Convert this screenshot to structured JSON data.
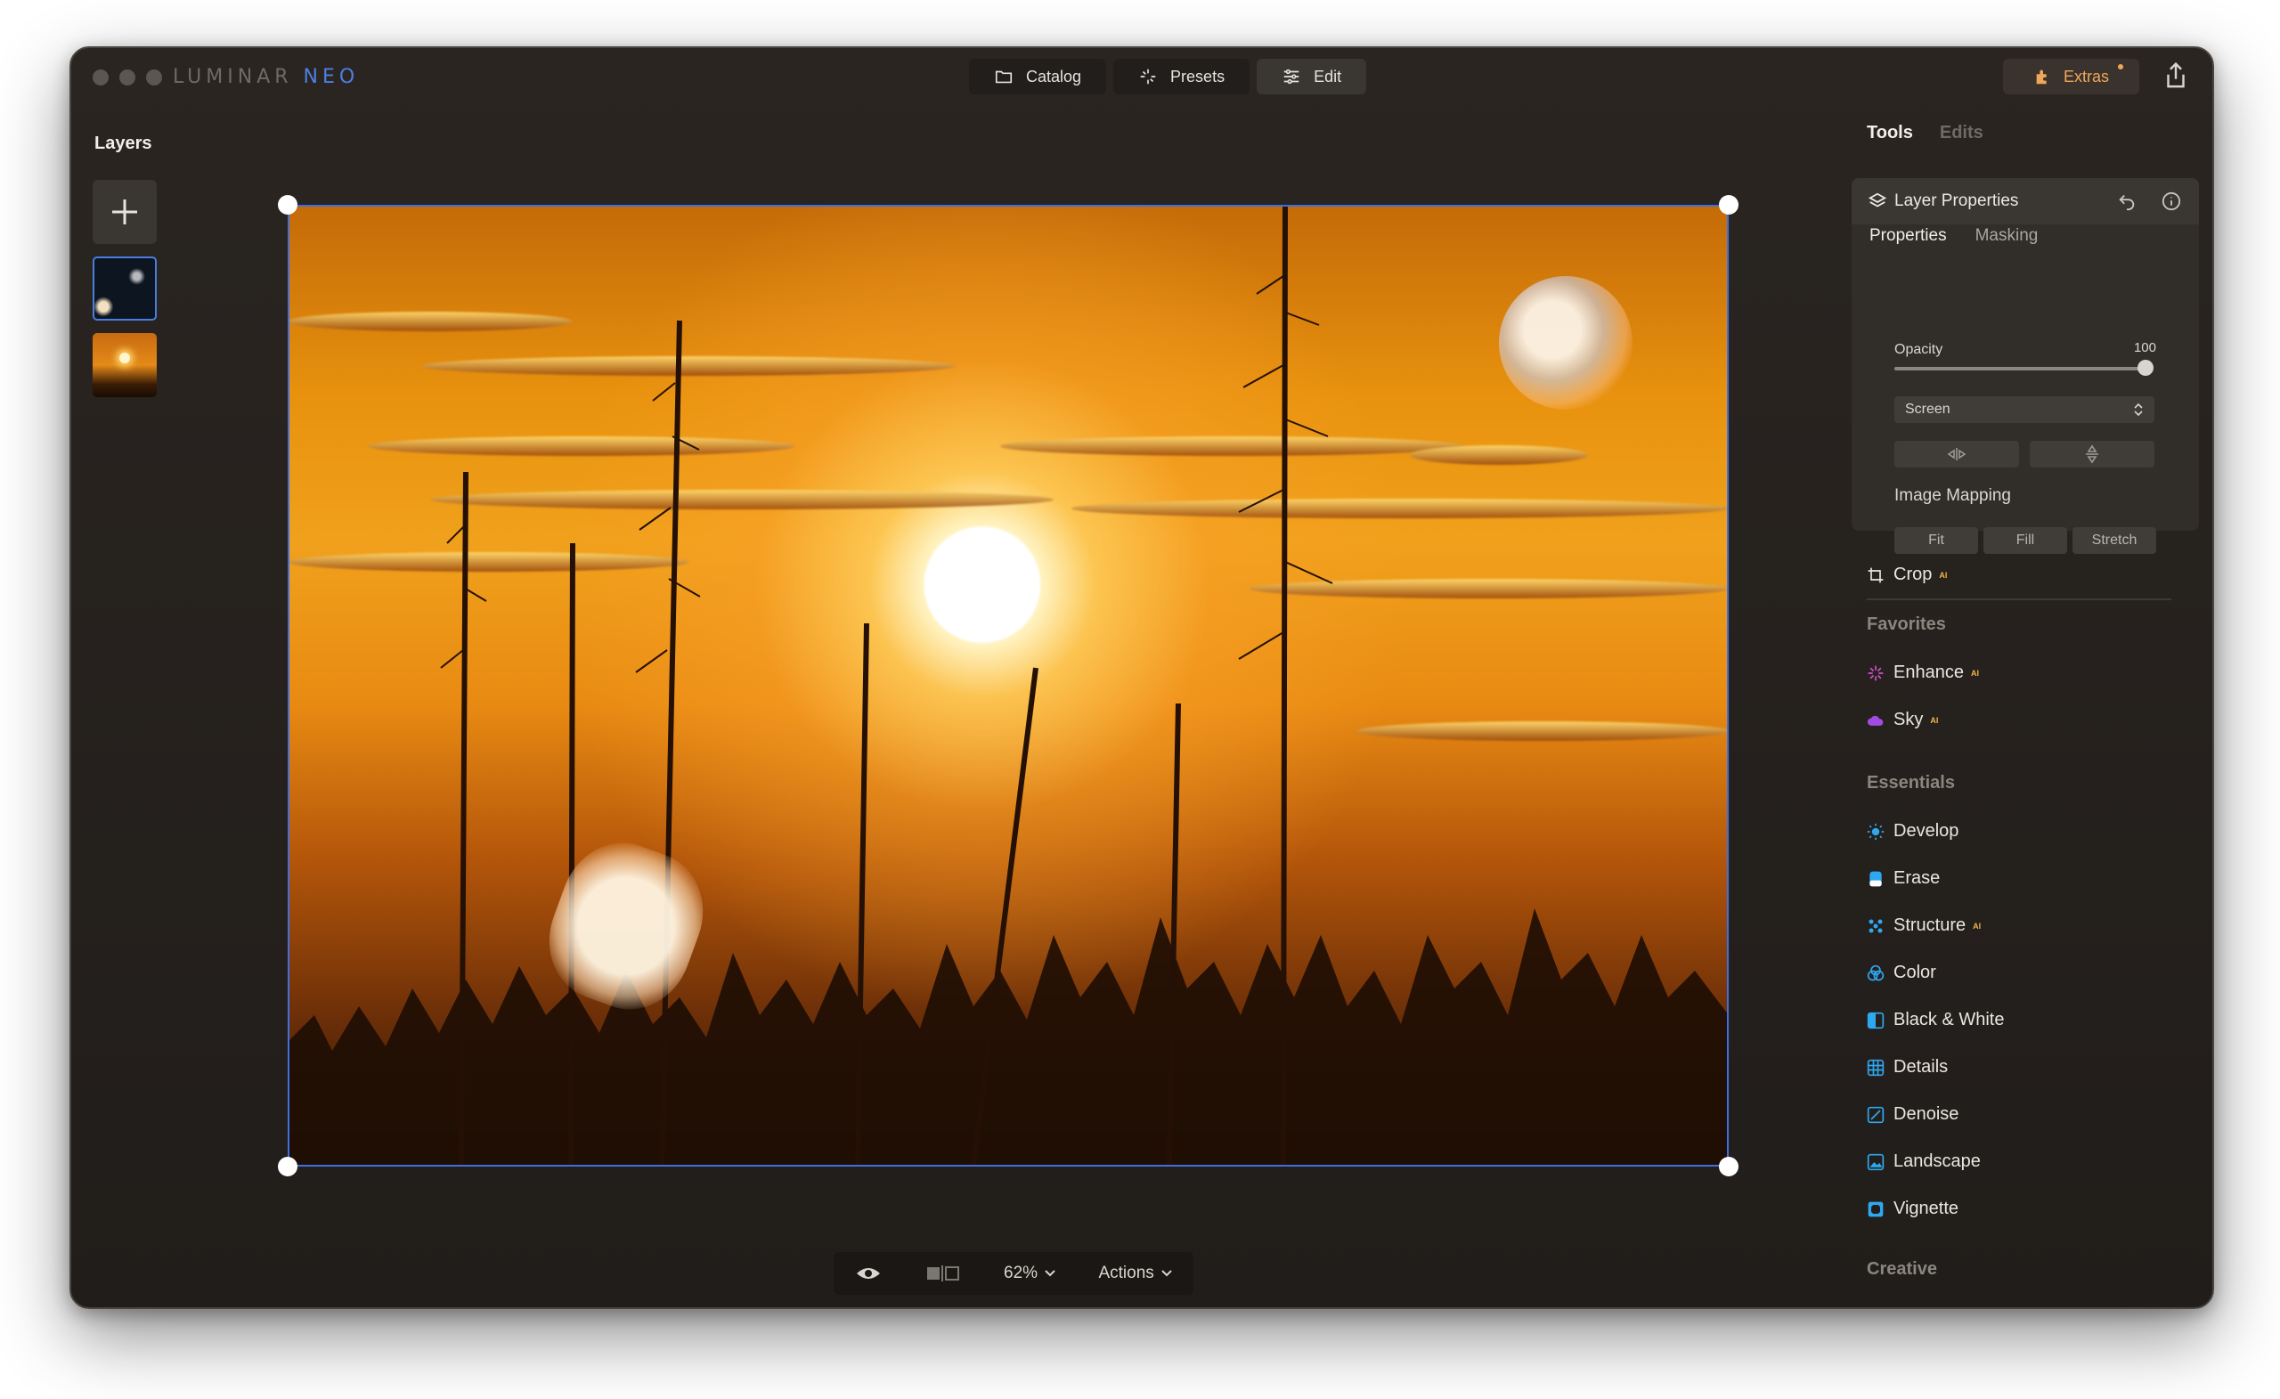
{
  "app": {
    "brand_main": "LUMINAR",
    "brand_neo": "NEO"
  },
  "modes": [
    {
      "label": "Catalog",
      "icon": "folder-icon"
    },
    {
      "label": "Presets",
      "icon": "sparkle-icon"
    },
    {
      "label": "Edit",
      "icon": "sliders-icon"
    }
  ],
  "extras": {
    "label": "Extras"
  },
  "layers": {
    "title": "Layers"
  },
  "bottombar": {
    "zoom": "62%",
    "actions": "Actions"
  },
  "right": {
    "tab_tools": "Tools",
    "tab_edits": "Edits",
    "layer_props": {
      "title": "Layer Properties",
      "tab_properties": "Properties",
      "tab_masking": "Masking",
      "opacity_label": "Opacity",
      "opacity_value": "100",
      "blend_mode": "Screen",
      "mapping_label": "Image Mapping",
      "fit": "Fit",
      "fill": "Fill",
      "stretch": "Stretch"
    },
    "crop": "Crop",
    "ai_badge": "AI",
    "favorites_title": "Favorites",
    "favorites": [
      "Enhance",
      "Sky"
    ],
    "essentials_title": "Essentials",
    "essentials": [
      "Develop",
      "Erase",
      "Structure",
      "Color",
      "Black & White",
      "Details",
      "Denoise",
      "Landscape",
      "Vignette"
    ],
    "creative_title": "Creative"
  },
  "colors": {
    "accent": "#3f6fe0",
    "extras": "#f0a65a",
    "ai": "#f0b44a"
  }
}
